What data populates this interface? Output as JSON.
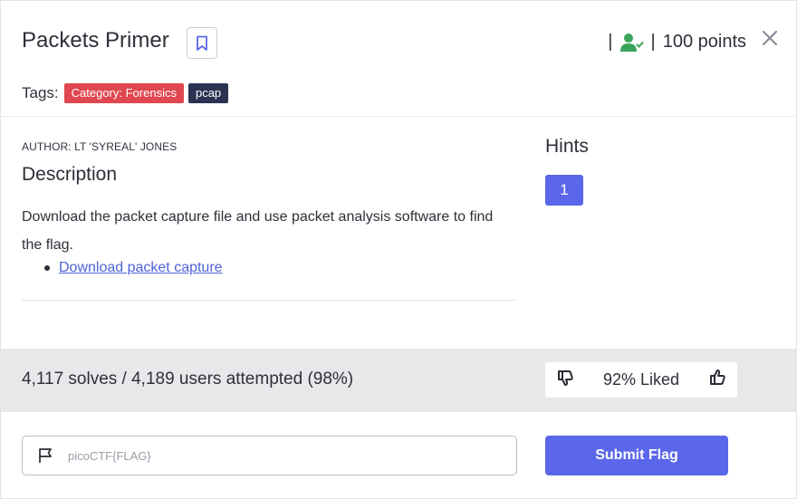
{
  "challenge": {
    "title": "Packets Primer",
    "points": "100 points",
    "tags_label": "Tags:",
    "tags": [
      "Category: Forensics",
      "pcap"
    ],
    "author": "AUTHOR: LT 'SYREAL' JONES",
    "description_heading": "Description",
    "description": "Download the packet capture file and use packet analysis software to find the flag.",
    "download_link": "Download packet capture"
  },
  "hints": {
    "heading": "Hints",
    "items": [
      "1"
    ]
  },
  "stats": {
    "solves": "4,117 solves / 4,189 users attempted (98%)",
    "liked": "92% Liked"
  },
  "flag": {
    "placeholder": "picoCTF{FLAG}",
    "submit_label": "Submit Flag"
  },
  "colors": {
    "accent": "#5b67ea",
    "forensics_tag": "#e0474f",
    "pcap_tag": "#2b3352",
    "solved_icon": "#3aa45a"
  },
  "icons": [
    "bookmark-icon",
    "user-check-icon",
    "close-icon",
    "thumbs-down-icon",
    "thumbs-up-icon",
    "flag-icon"
  ]
}
